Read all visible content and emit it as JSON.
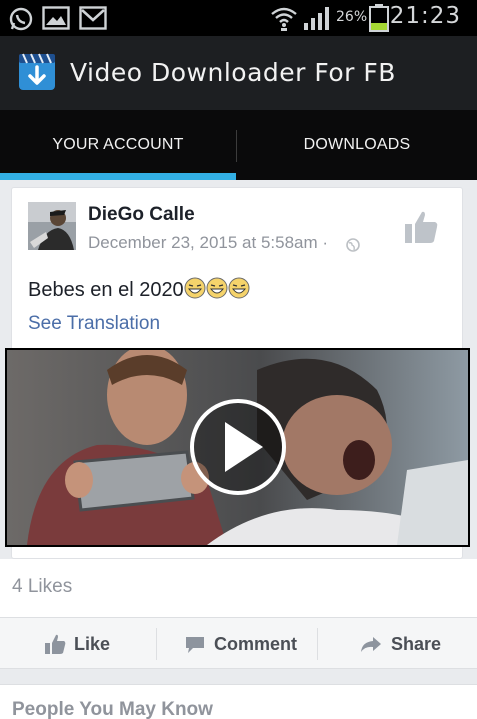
{
  "status_bar": {
    "battery": "26%",
    "time": "21:23"
  },
  "app": {
    "title": "Video Downloader For FB"
  },
  "tabs": [
    {
      "label": "YOUR ACCOUNT",
      "selected": true
    },
    {
      "label": "DOWNLOADS",
      "selected": false
    }
  ],
  "post": {
    "author": "DieGo Calle",
    "date": "December 23, 2015 at 5:58am",
    "date_separator": "·",
    "text": "Bebes en el 2020",
    "emoji_count": 3,
    "see_translation": "See Translation",
    "likes": "4 Likes"
  },
  "actions": {
    "like": "Like",
    "comment": "Comment",
    "share": "Share"
  },
  "pymk": {
    "title": "People You May Know"
  },
  "colors": {
    "tab_indicator": "#33b0e5",
    "link": "#4b6ea8",
    "action_bar": "#1d1f22"
  }
}
